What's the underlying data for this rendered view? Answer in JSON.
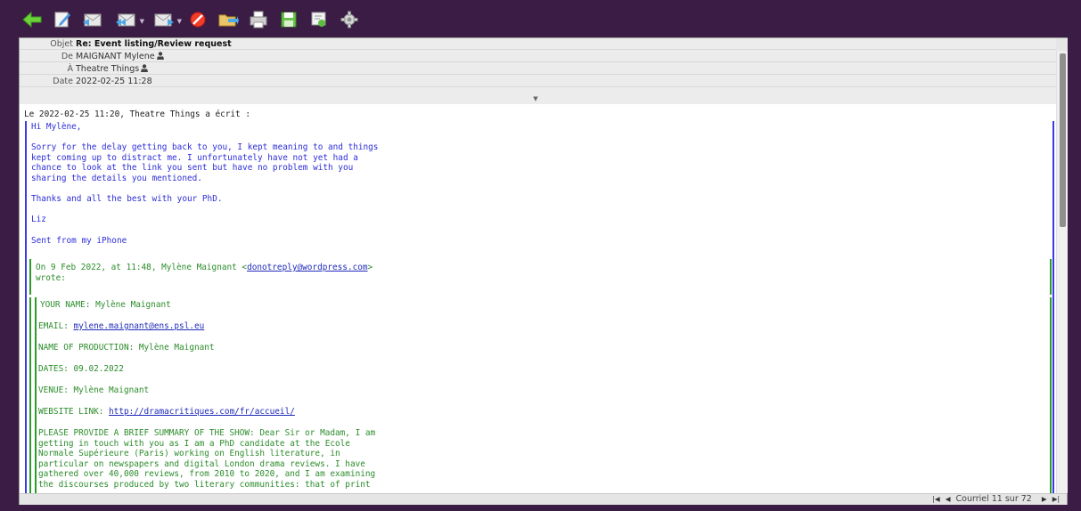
{
  "toolbar": {
    "icons": [
      "back-arrow-icon",
      "compose-icon",
      "reply-icon",
      "reply-all-icon",
      "forward-icon",
      "block-icon",
      "move-to-folder-icon",
      "print-icon",
      "save-icon",
      "certificate-icon",
      "settings-gear-icon"
    ]
  },
  "headers": {
    "subject_label": "Objet",
    "subject": "Re: Event listing/Review request",
    "from_label": "De",
    "from": "MAIGNANT Mylene",
    "to_label": "À",
    "to": "Theatre Things",
    "date_label": "Date",
    "date": "2022-02-25 11:28"
  },
  "body": {
    "intro": "Le 2022-02-25 11:20, Theatre Things a écrit :",
    "reply_lines": [
      "Hi Mylène,",
      "",
      "Sorry for the delay getting back to you, I kept meaning to and things",
      "kept coming up to distract me. I unfortunately have not yet had a",
      "chance to look at the link you sent but have no problem with you",
      "sharing the details you mentioned.",
      "",
      "Thanks and all the best with your PhD.",
      "",
      "Liz",
      "",
      "Sent from my iPhone"
    ],
    "quote_header_prefix": "On 9 Feb 2022, at 11:48, Mylène Maignant <",
    "quote_header_email": "donotreply@wordpress.com",
    "quote_header_suffix": ">",
    "quote_header_line2": "wrote:",
    "form": {
      "name": "YOUR NAME: Mylène Maignant",
      "email_label": "EMAIL: ",
      "email": "mylene.maignant@ens.psl.eu",
      "production": "NAME OF PRODUCTION: Mylène Maignant",
      "dates": "DATES: 09.02.2022",
      "venue": "VENUE: Mylène Maignant",
      "website_label": "WEBSITE LINK: ",
      "website": "http://dramacritiques.com/fr/accueil/",
      "summary_lines": [
        "PLEASE PROVIDE A BRIEF SUMMARY OF THE SHOW: Dear Sir or Madam, I am",
        "getting in touch with you as I am a PhD candidate at the Ecole",
        "Normale Supérieure (Paris) working on English literature, in",
        "particular on newspapers and digital London drama reviews. I have",
        "gathered over 40,000 reviews, from 2010 to 2020, and I am examining",
        "the discourses produced by two literary communities: that of print"
      ]
    }
  },
  "status": {
    "counter": "Courriel 11 sur 72"
  },
  "colors": {
    "frame": "#3b1c45",
    "reply_text": "#2d2dd8",
    "quote_text": "#2c8c2c",
    "link": "#1f2bb8"
  }
}
